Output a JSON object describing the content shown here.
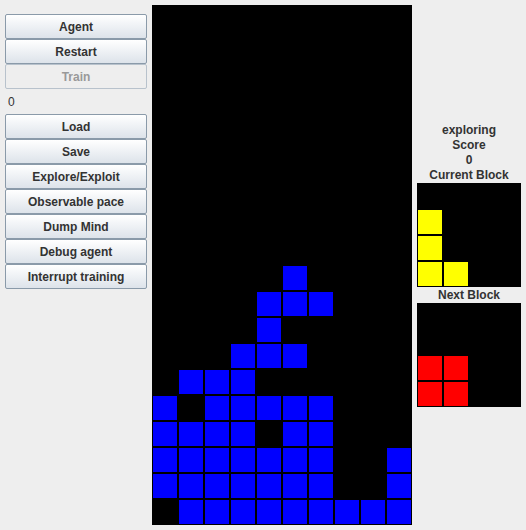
{
  "sidebar": {
    "items": [
      {
        "kind": "button",
        "label": "Agent",
        "disabled": false
      },
      {
        "kind": "button",
        "label": "Restart",
        "disabled": false
      },
      {
        "kind": "button",
        "label": "Train",
        "disabled": true
      },
      {
        "kind": "field",
        "value": "0"
      },
      {
        "kind": "button",
        "label": "Load",
        "disabled": false
      },
      {
        "kind": "button",
        "label": "Save",
        "disabled": false
      },
      {
        "kind": "button",
        "label": "Explore/Exploit",
        "disabled": false
      },
      {
        "kind": "button",
        "label": "Observable pace",
        "disabled": false
      },
      {
        "kind": "button",
        "label": "Dump Mind",
        "disabled": false
      },
      {
        "kind": "button",
        "label": "Debug agent",
        "disabled": false
      },
      {
        "kind": "button",
        "label": "Interrupt training",
        "disabled": false
      }
    ]
  },
  "board": {
    "color": "#0000ff",
    "rows": [
      [
        0,
        0,
        0,
        0,
        0,
        0,
        0,
        0,
        0,
        0
      ],
      [
        0,
        0,
        0,
        0,
        0,
        0,
        0,
        0,
        0,
        0
      ],
      [
        0,
        0,
        0,
        0,
        0,
        0,
        0,
        0,
        0,
        0
      ],
      [
        0,
        0,
        0,
        0,
        0,
        0,
        0,
        0,
        0,
        0
      ],
      [
        0,
        0,
        0,
        0,
        0,
        0,
        0,
        0,
        0,
        0
      ],
      [
        0,
        0,
        0,
        0,
        0,
        0,
        0,
        0,
        0,
        0
      ],
      [
        0,
        0,
        0,
        0,
        0,
        0,
        0,
        0,
        0,
        0
      ],
      [
        0,
        0,
        0,
        0,
        0,
        0,
        0,
        0,
        0,
        0
      ],
      [
        0,
        0,
        0,
        0,
        0,
        0,
        0,
        0,
        0,
        0
      ],
      [
        0,
        0,
        0,
        0,
        0,
        0,
        0,
        0,
        0,
        0
      ],
      [
        0,
        0,
        0,
        0,
        0,
        1,
        0,
        0,
        0,
        0
      ],
      [
        0,
        0,
        0,
        0,
        1,
        1,
        1,
        0,
        0,
        0
      ],
      [
        0,
        0,
        0,
        0,
        1,
        0,
        0,
        0,
        0,
        0
      ],
      [
        0,
        0,
        0,
        1,
        1,
        1,
        0,
        0,
        0,
        0
      ],
      [
        0,
        1,
        1,
        1,
        0,
        0,
        0,
        0,
        0,
        0
      ],
      [
        1,
        0,
        1,
        1,
        1,
        1,
        1,
        0,
        0,
        0
      ],
      [
        1,
        1,
        1,
        1,
        0,
        1,
        1,
        0,
        0,
        0
      ],
      [
        1,
        1,
        1,
        1,
        1,
        1,
        1,
        0,
        0,
        1
      ],
      [
        1,
        1,
        1,
        1,
        1,
        1,
        1,
        0,
        0,
        1
      ],
      [
        0,
        1,
        1,
        1,
        1,
        1,
        1,
        1,
        1,
        1
      ]
    ]
  },
  "panel": {
    "status": "exploring",
    "score_label": "Score",
    "score": "0",
    "current_block": {
      "label": "Current Block",
      "color": "#ffff00",
      "cells": [
        [
          0,
          0,
          0,
          0
        ],
        [
          1,
          0,
          0,
          0
        ],
        [
          1,
          0,
          0,
          0
        ],
        [
          1,
          1,
          0,
          0
        ]
      ]
    },
    "next_block": {
      "label": "Next Block",
      "color": "#ff0000",
      "cells": [
        [
          0,
          0,
          0,
          0
        ],
        [
          0,
          0,
          0,
          0
        ],
        [
          1,
          1,
          0,
          0
        ],
        [
          1,
          1,
          0,
          0
        ]
      ]
    }
  }
}
